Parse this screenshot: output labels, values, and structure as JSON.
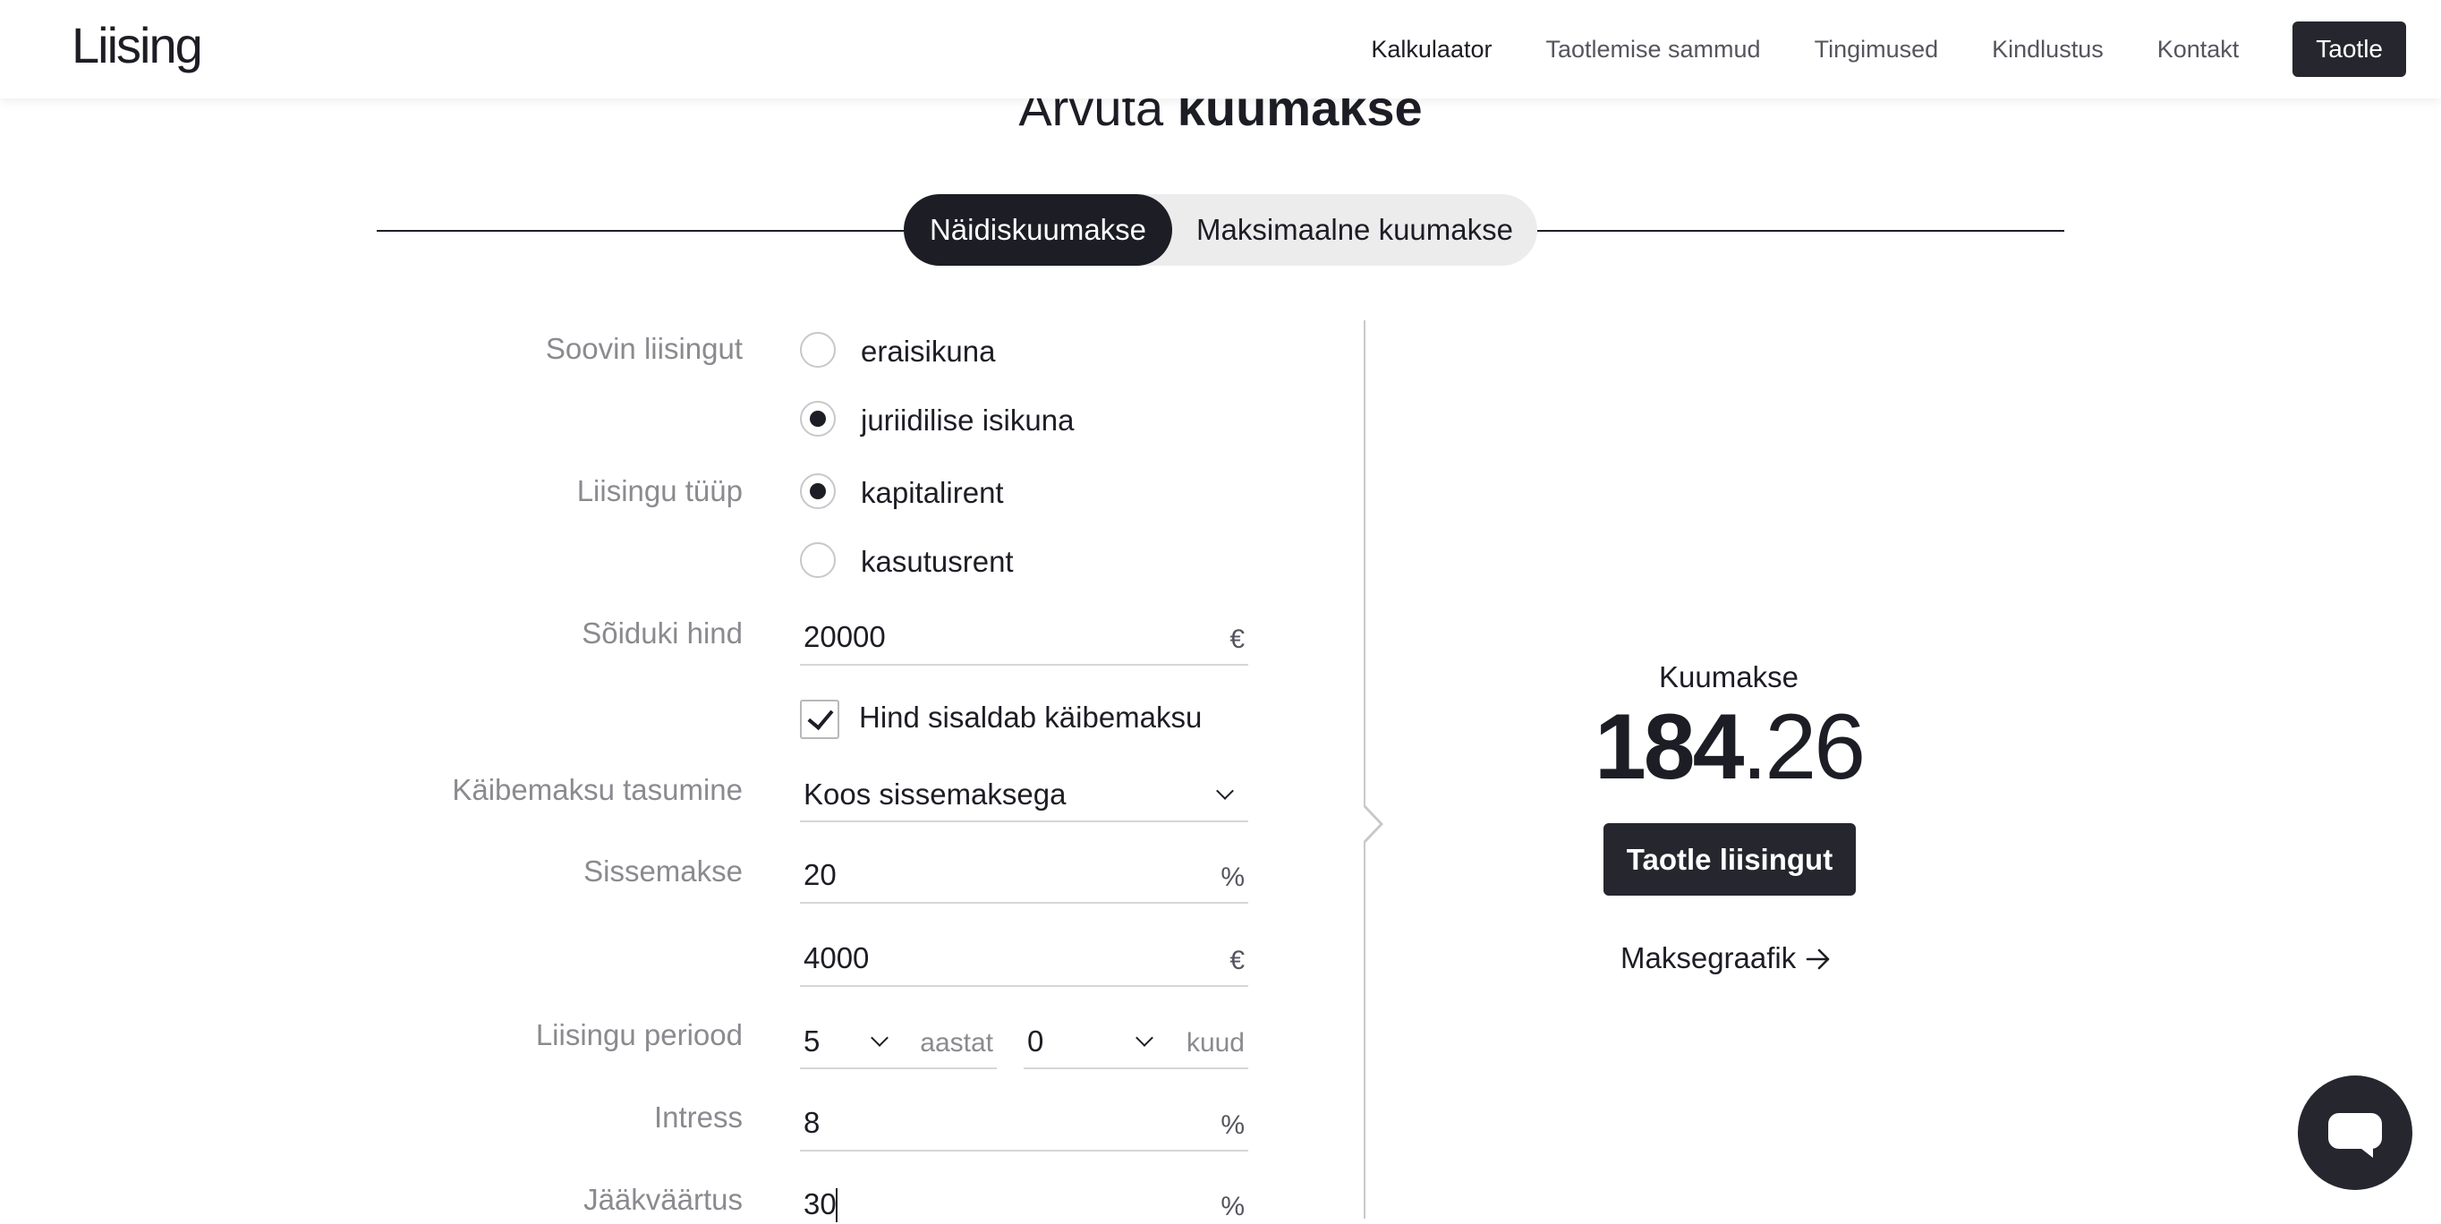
{
  "header": {
    "logo": "Liising",
    "nav": [
      "Kalkulaator",
      "Taotlemise sammud",
      "Tingimused",
      "Kindlustus",
      "Kontakt"
    ],
    "cta": "Taotle"
  },
  "title": {
    "prefix": "Arvuta",
    "bold": "kuumakse"
  },
  "tabs": {
    "active": "Näidiskuumakse",
    "inactive": "Maksimaalne kuumakse"
  },
  "form": {
    "applicant": {
      "label": "Soovin liisingut",
      "options": [
        "eraisikuna",
        "juriidilise isikuna"
      ],
      "selected": "juriidilise isikuna"
    },
    "leasing_type": {
      "label": "Liisingu tüüp",
      "options": [
        "kapitalirent",
        "kasutusrent"
      ],
      "selected": "kapitalirent"
    },
    "vehicle_price": {
      "label": "Sõiduki hind",
      "value": "20000",
      "unit": "€"
    },
    "vat_included": {
      "label": "Hind sisaldab käibemaksu",
      "checked": true
    },
    "vat_payment": {
      "label": "Käibemaksu tasumine",
      "value": "Koos sissemaksega"
    },
    "down_payment": {
      "label": "Sissemakse",
      "percent": "20",
      "percent_unit": "%",
      "amount": "4000",
      "amount_unit": "€"
    },
    "period": {
      "label": "Liisingu periood",
      "years": "5",
      "years_unit": "aastat",
      "months": "0",
      "months_unit": "kuud"
    },
    "interest": {
      "label": "Intress",
      "value": "8",
      "unit": "%"
    },
    "residual": {
      "label": "Jääkväärtus",
      "value": "30",
      "unit": "%"
    }
  },
  "result": {
    "label": "Kuumakse",
    "integer": "184",
    "separator": ".",
    "decimal": "26",
    "apply_button": "Taotle liisingut",
    "schedule_link": "Maksegraafik"
  },
  "colors": {
    "primary": "#1d1d25",
    "button": "#25262e",
    "muted": "#8a8a8f",
    "line": "#d6d6da",
    "tab_bg": "#ececec"
  },
  "icons": [
    "chevron-down-icon",
    "check-icon",
    "arrow-right-icon",
    "chat-icon"
  ]
}
